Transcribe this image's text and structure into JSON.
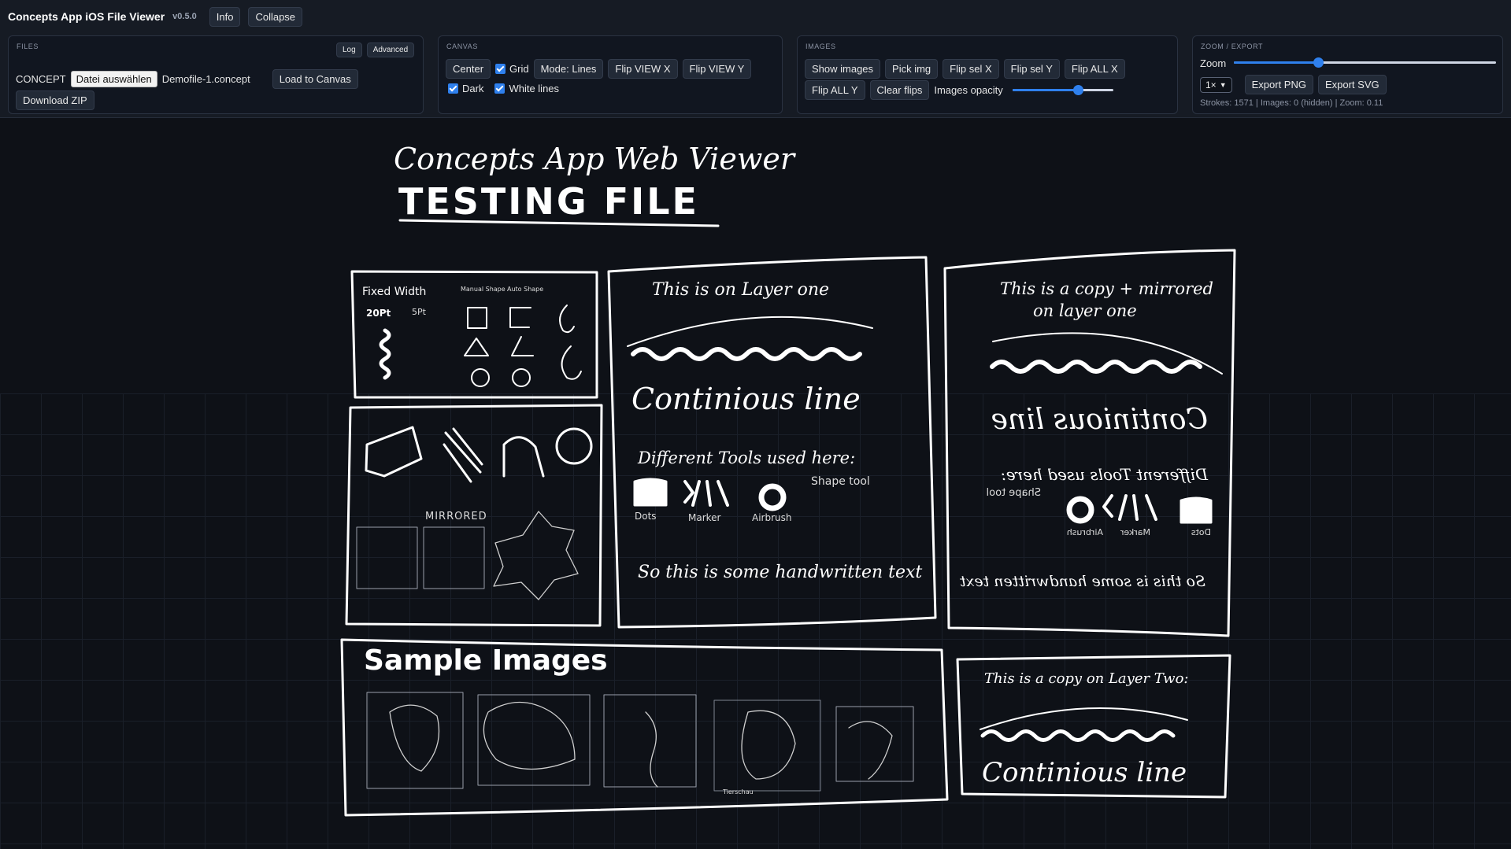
{
  "header": {
    "app_title": "Concepts App iOS File Viewer",
    "version": "v0.5.0",
    "info_label": "Info",
    "collapse_label": "Collapse"
  },
  "files": {
    "title": "FILES",
    "log_label": "Log",
    "advanced_label": "Advanced",
    "concept_label": "CONCEPT",
    "choose_file_label": "Datei auswählen",
    "file_name": "Demofile-1.concept",
    "load_label": "Load to Canvas",
    "download_label": "Download ZIP"
  },
  "canvas_panel": {
    "title": "CANVAS",
    "center_label": "Center",
    "grid_label": "Grid",
    "grid_checked": true,
    "mode_label": "Mode: Lines",
    "flip_view_x": "Flip VIEW X",
    "flip_view_y": "Flip VIEW Y",
    "dark_label": "Dark",
    "dark_checked": true,
    "white_lines_label": "White lines",
    "white_lines_checked": true
  },
  "images_panel": {
    "title": "IMAGES",
    "show_images": "Show images",
    "pick_img": "Pick img",
    "flip_sel_x": "Flip sel X",
    "flip_sel_y": "Flip sel Y",
    "flip_all_x": "Flip ALL X",
    "flip_all_y": "Flip ALL Y",
    "clear_flips": "Clear flips",
    "opacity_label": "Images opacity",
    "opacity_value": 0.65
  },
  "zoom_panel": {
    "title": "ZOOM / EXPORT",
    "zoom_label": "Zoom",
    "zoom_value": 0.32,
    "scale_value": "1×",
    "export_png": "Export PNG",
    "export_svg": "Export SVG",
    "stats": "Strokes: 1571 | Images: 0 (hidden) | Zoom: 0.11"
  },
  "drawing": {
    "title_line": "Concepts App Web Viewer",
    "subtitle": "TESTING FILE",
    "fixed_width": "Fixed Width",
    "pt20": "20Pt",
    "pt5": "5Pt",
    "manual_shape": "Manual Shape",
    "auto_shape": "Auto Shape",
    "mirrored": "MIRRORED",
    "layer_one": "This is on Layer one",
    "continuous_line": "Continious line",
    "different_tools": "Different Tools used here:",
    "shape_tool": "Shape tool",
    "dots": "Dots",
    "marker": "Marker",
    "airbrush": "Airbrush",
    "handwritten": "So this is some handwritten text",
    "copy_mirrored_1": "This is a copy + mirrored",
    "copy_mirrored_2": "on layer one",
    "sample_images": "Sample Images",
    "copy_layer_two": "This is a copy on Layer Two:",
    "sketch_caption": "Tierschau"
  }
}
